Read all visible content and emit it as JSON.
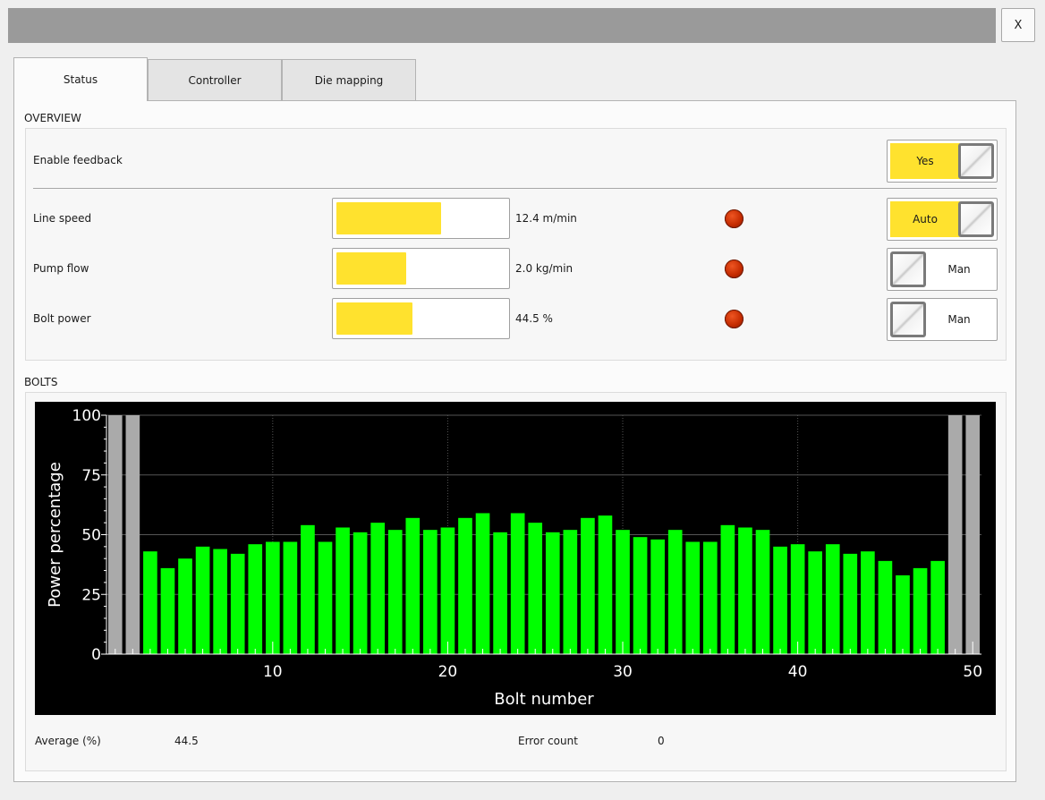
{
  "window": {
    "close_label": "X"
  },
  "tabs": [
    {
      "label": "Status",
      "active": true
    },
    {
      "label": "Controller",
      "active": false
    },
    {
      "label": "Die mapping",
      "active": false
    }
  ],
  "overview": {
    "title": "OVERVIEW",
    "enable_feedback": {
      "label": "Enable feedback",
      "toggle_label": "Yes",
      "on": true
    },
    "rows": [
      {
        "label": "Line speed",
        "value_text": "12.4 m/min",
        "fill_fraction": 0.61,
        "indicator_color": "#c42b00",
        "toggle_label": "Auto",
        "toggle_on": true
      },
      {
        "label": "Pump flow",
        "value_text": "2.0 kg/min",
        "fill_fraction": 0.41,
        "indicator_color": "#c42b00",
        "toggle_label": "Man",
        "toggle_on": false
      },
      {
        "label": "Bolt power",
        "value_text": "44.5 %",
        "fill_fraction": 0.445,
        "indicator_color": "#c42b00",
        "toggle_label": "Man",
        "toggle_on": false
      }
    ]
  },
  "bolts": {
    "title": "BOLTS",
    "average_label": "Average (%)",
    "average_value": "44.5",
    "error_label": "Error count",
    "error_value": "0"
  },
  "colors": {
    "accent": "#ffe22e",
    "bar": "#00ff00",
    "inactive_bar": "#aaaaaa",
    "led": "#c42b00"
  },
  "chart_data": {
    "type": "bar",
    "xlabel": "Bolt number",
    "ylabel": "Power percentage",
    "xlim": [
      0.5,
      50.5
    ],
    "ylim": [
      0,
      100
    ],
    "xticks": [
      10,
      20,
      30,
      40,
      50
    ],
    "yticks": [
      0,
      25,
      50,
      75,
      100
    ],
    "inactive_bolts": [
      1,
      2,
      49,
      50
    ],
    "inactive_value": 100,
    "bolts": [
      3,
      4,
      5,
      6,
      7,
      8,
      9,
      10,
      11,
      12,
      13,
      14,
      15,
      16,
      17,
      18,
      19,
      20,
      21,
      22,
      23,
      24,
      25,
      26,
      27,
      28,
      29,
      30,
      31,
      32,
      33,
      34,
      35,
      36,
      37,
      38,
      39,
      40,
      41,
      42,
      43,
      44,
      45,
      46,
      47,
      48
    ],
    "values": [
      43,
      36,
      40,
      45,
      44,
      42,
      46,
      47,
      47,
      54,
      47,
      53,
      51,
      55,
      52,
      57,
      52,
      53,
      57,
      59,
      51,
      59,
      55,
      51,
      52,
      57,
      58,
      52,
      49,
      48,
      52,
      47,
      47,
      54,
      53,
      52,
      45,
      46,
      43,
      46,
      42,
      43,
      39,
      33,
      36,
      39
    ],
    "grid": true
  }
}
